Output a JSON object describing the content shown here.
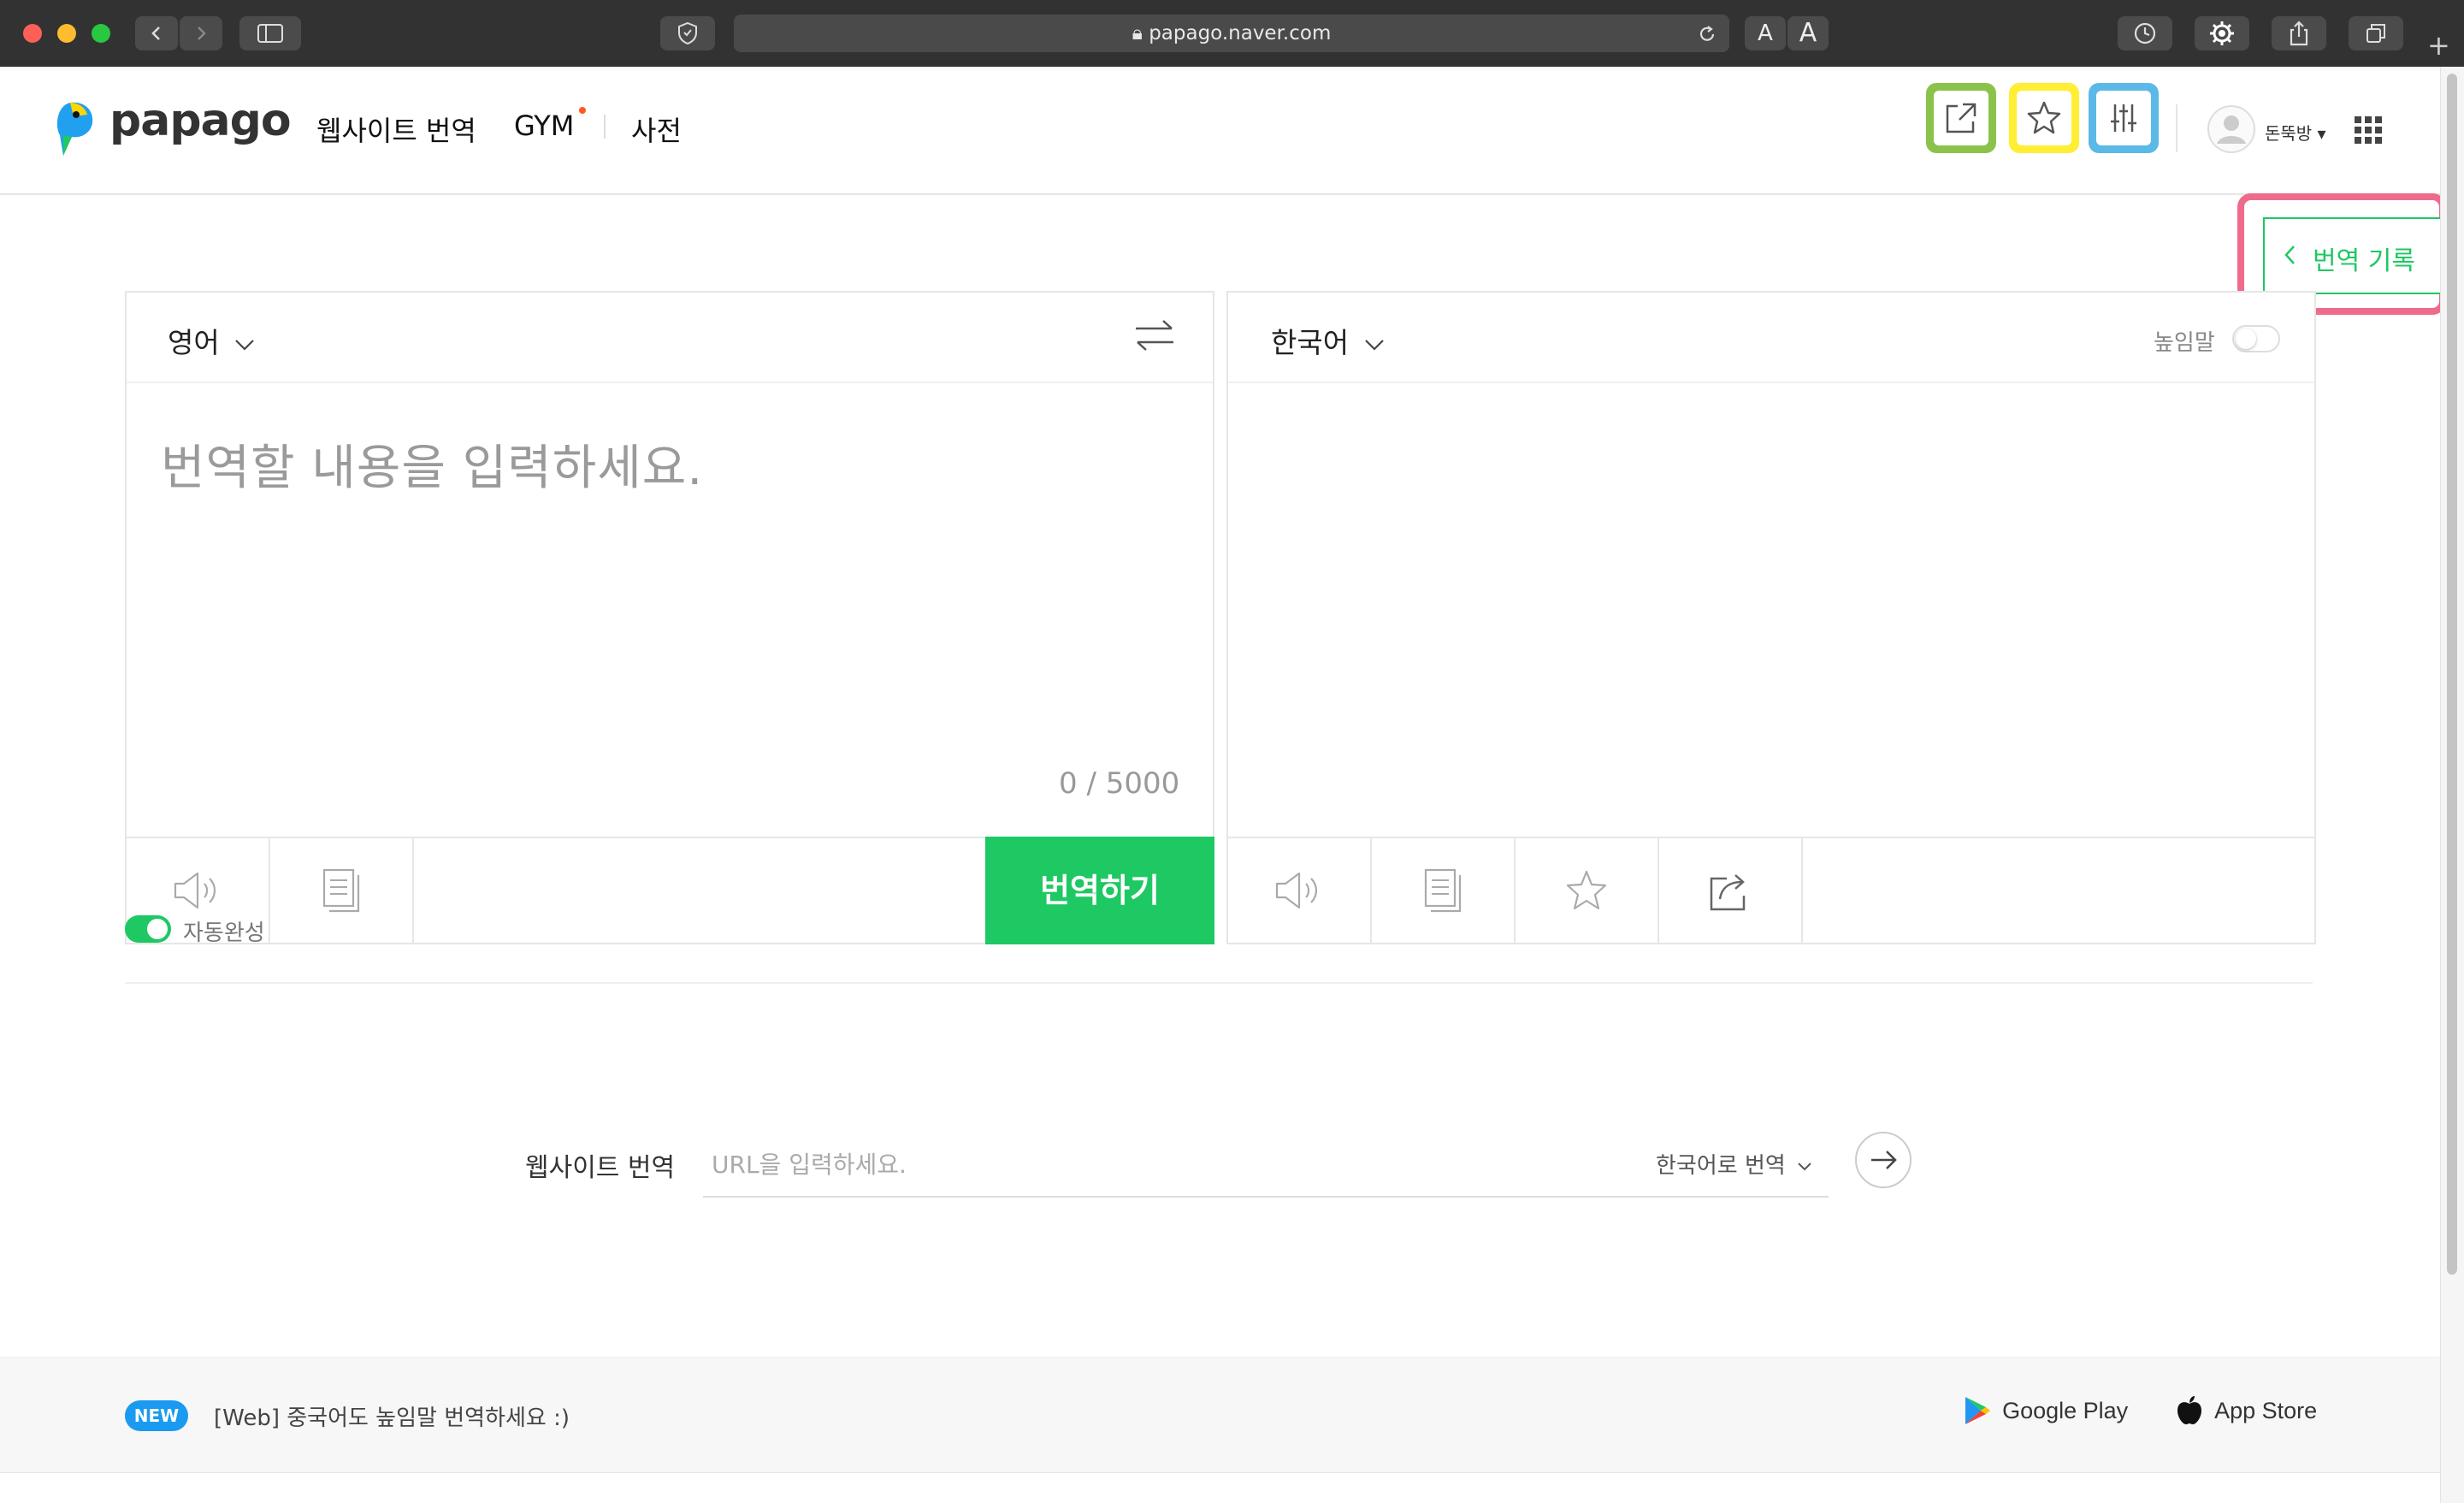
{
  "browser": {
    "url": "papago.naver.com",
    "font_smaller": "A",
    "font_larger": "A"
  },
  "header": {
    "logo": "papago",
    "nav": [
      "웹사이트 번역",
      "GYM",
      "사전"
    ],
    "user_name": "돈뚝방 ▾"
  },
  "history_button": {
    "label": "번역 기록"
  },
  "source": {
    "language": "영어",
    "placeholder": "번역할 내용을 입력하세요.",
    "counter": "0 / 5000",
    "translate_button": "번역하기"
  },
  "target": {
    "language": "한국어",
    "honorific_label": "높임말"
  },
  "autocomplete": {
    "label": "자동완성"
  },
  "website_translate": {
    "label": "웹사이트 번역",
    "url_placeholder": "URL을 입력하세요.",
    "target_option": "한국어로 번역"
  },
  "footer": {
    "new_badge": "NEW",
    "news": "[Web] 중국어도 높임말 번역하세요 :)",
    "google_play": "Google Play",
    "app_store": "App Store"
  },
  "colors": {
    "brand_green": "#1ec863",
    "highlight_green": "#8bc34a",
    "highlight_yellow": "#ffee33",
    "highlight_blue": "#5bb9e8",
    "highlight_pink": "#ee6b8b",
    "new_badge_blue": "#1a9af0"
  }
}
